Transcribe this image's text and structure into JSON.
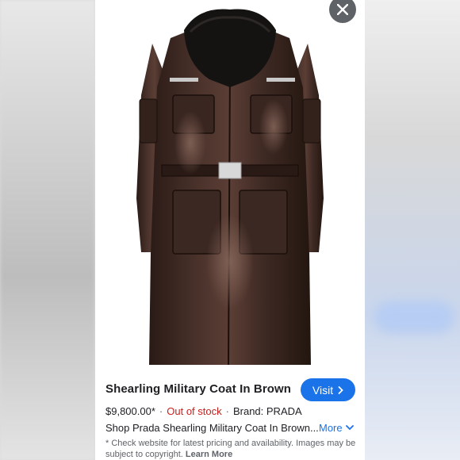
{
  "product": {
    "title": "Shearling Military Coat In Brown",
    "price": "$9,800.00*",
    "stock_status": "Out of stock",
    "brand": "Brand: PRADA",
    "shop_text": "Shop Prada Shearling Military Coat In Brown...",
    "more_label": "More",
    "visit_label": "Visit",
    "disclaimer": "* Check website for latest pricing and availability. Images may be subject to copyright.",
    "learn_more_label": "Learn More",
    "image_icon": "brown-leather-coat-photo"
  },
  "icons": {
    "close": "close-icon",
    "visit_chevron": "chevron-right-icon",
    "more_chevron": "chevron-down-icon"
  },
  "colors": {
    "accent": "#1a73e8",
    "stock_red": "#c5221f",
    "coat_brown": "#3a2620",
    "close_bg": "#5f6368"
  }
}
